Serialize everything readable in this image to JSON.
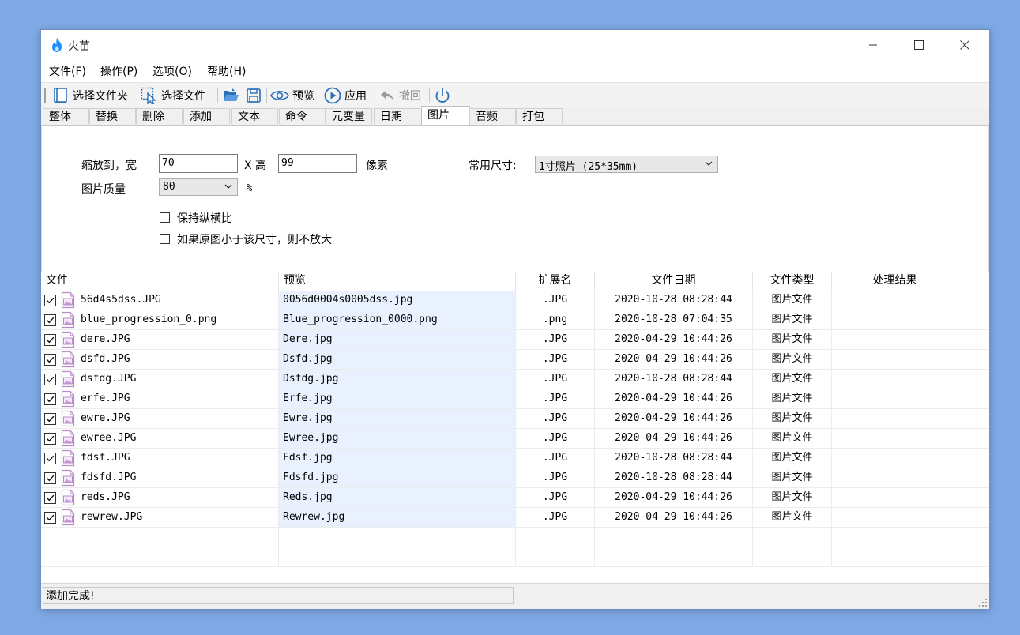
{
  "app": {
    "title": "火苗"
  },
  "menu": [
    "文件(F)",
    "操作(P)",
    "选项(O)",
    "帮助(H)"
  ],
  "toolbar": {
    "select_folder": "选择文件夹",
    "select_file": "选择文件",
    "preview": "预览",
    "apply": "应用",
    "undo": "撤回"
  },
  "tabs": [
    "整体",
    "替换",
    "删除",
    "添加",
    "文本",
    "命令",
    "元变量",
    "日期",
    "图片",
    "音频",
    "打包"
  ],
  "active_tab": "图片",
  "image_panel": {
    "scale_label": "缩放到，宽",
    "width_value": "70",
    "x_label": "X 高",
    "height_value": "99",
    "pixel_label": "像素",
    "common_size_label": "常用尺寸:",
    "common_size_value": "1寸照片 (25*35mm)",
    "quality_label": "图片质量",
    "quality_value": "80",
    "percent_label": "%",
    "keep_ratio_label": "保持纵横比",
    "no_enlarge_label": "如果原图小于该尺寸，则不放大"
  },
  "grid": {
    "columns": [
      "文件",
      "预览",
      "扩展名",
      "文件日期",
      "文件类型",
      "处理结果"
    ],
    "rows": [
      {
        "file": "56d4s5dss.JPG",
        "preview": "0056d0004s0005dss.jpg",
        "ext": ".JPG",
        "date": "2020-10-28 08:28:44",
        "type": "图片文件",
        "result": ""
      },
      {
        "file": "blue_progression_0.png",
        "preview": "Blue_progression_0000.png",
        "ext": ".png",
        "date": "2020-10-28 07:04:35",
        "type": "图片文件",
        "result": ""
      },
      {
        "file": "dere.JPG",
        "preview": "Dere.jpg",
        "ext": ".JPG",
        "date": "2020-04-29 10:44:26",
        "type": "图片文件",
        "result": ""
      },
      {
        "file": "dsfd.JPG",
        "preview": "Dsfd.jpg",
        "ext": ".JPG",
        "date": "2020-04-29 10:44:26",
        "type": "图片文件",
        "result": ""
      },
      {
        "file": "dsfdg.JPG",
        "preview": "Dsfdg.jpg",
        "ext": ".JPG",
        "date": "2020-10-28 08:28:44",
        "type": "图片文件",
        "result": ""
      },
      {
        "file": "erfe.JPG",
        "preview": "Erfe.jpg",
        "ext": ".JPG",
        "date": "2020-04-29 10:44:26",
        "type": "图片文件",
        "result": ""
      },
      {
        "file": "ewre.JPG",
        "preview": "Ewre.jpg",
        "ext": ".JPG",
        "date": "2020-04-29 10:44:26",
        "type": "图片文件",
        "result": ""
      },
      {
        "file": "ewree.JPG",
        "preview": "Ewree.jpg",
        "ext": ".JPG",
        "date": "2020-04-29 10:44:26",
        "type": "图片文件",
        "result": ""
      },
      {
        "file": "fdsf.JPG",
        "preview": "Fdsf.jpg",
        "ext": ".JPG",
        "date": "2020-10-28 08:28:44",
        "type": "图片文件",
        "result": ""
      },
      {
        "file": "fdsfd.JPG",
        "preview": "Fdsfd.jpg",
        "ext": ".JPG",
        "date": "2020-10-28 08:28:44",
        "type": "图片文件",
        "result": ""
      },
      {
        "file": "reds.JPG",
        "preview": "Reds.jpg",
        "ext": ".JPG",
        "date": "2020-04-29 10:44:26",
        "type": "图片文件",
        "result": ""
      },
      {
        "file": "rewrew.JPG",
        "preview": "Rewrew.jpg",
        "ext": ".JPG",
        "date": "2020-04-29 10:44:26",
        "type": "图片文件",
        "result": ""
      }
    ]
  },
  "status": {
    "message": "添加完成!"
  },
  "colors": {
    "accent": "#1e90ff",
    "preview_bg": "#e8f1fd",
    "desktop": "#7fa9e6"
  }
}
